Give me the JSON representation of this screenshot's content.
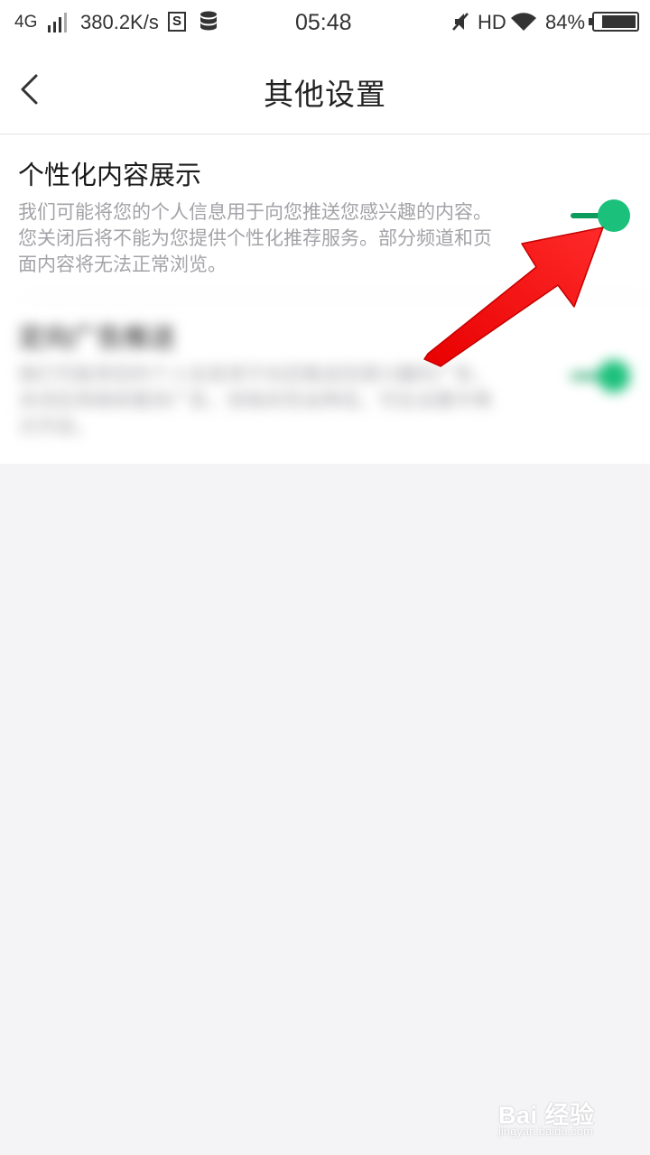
{
  "status_bar": {
    "network": "4G",
    "speed": "380.2K/s",
    "s_icon_letter": "S",
    "time": "05:48",
    "hd": "HD",
    "battery_text": "84%",
    "battery_level": 0.84
  },
  "header": {
    "title": "其他设置",
    "back_icon": "chevron-left-icon"
  },
  "settings": [
    {
      "title": "个性化内容展示",
      "desc": "我们可能将您的个人信息用于向您推送您感兴趣的内容。您关闭后将不能为您提供个性化推荐服务。部分频道和页面内容将无法正常浏览。",
      "enabled": true
    },
    {
      "title": "定向广告推送",
      "desc": "我们可能将您的个人信息用于向您推送您感兴趣的广告，关闭后将继续看到广告，但相关性会降低，可在设置中再次开启。",
      "enabled": true
    }
  ],
  "colors": {
    "toggle_on_knob": "#1bc07b",
    "toggle_on_track": "#0e9c5d",
    "annotation_arrow": "#ff1111"
  },
  "watermark": {
    "brand": "Bai 经验",
    "sub": "jingyan.baidu.com"
  }
}
